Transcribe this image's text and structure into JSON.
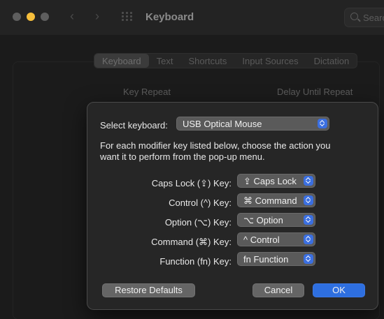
{
  "window": {
    "title": "Keyboard"
  },
  "search": {
    "placeholder": "Search"
  },
  "tabs": [
    "Keyboard",
    "Text",
    "Shortcuts",
    "Input Sources",
    "Dictation"
  ],
  "background": {
    "key_repeat_label": "Key Repeat",
    "delay_label": "Delay Until Repeat"
  },
  "sheet": {
    "select_keyboard_label": "Select keyboard:",
    "select_keyboard_value": "USB Optical Mouse",
    "description_line1": "For each modifier key listed below, choose the action you",
    "description_line2": "want it to perform from the pop-up menu.",
    "rows": [
      {
        "label": "Caps Lock (⇪) Key:",
        "value": "⇪ Caps Lock"
      },
      {
        "label": "Control (^) Key:",
        "value": "⌘ Command"
      },
      {
        "label": "Option (⌥) Key:",
        "value": "⌥ Option"
      },
      {
        "label": "Command (⌘) Key:",
        "value": "^ Control"
      },
      {
        "label": "Function (fn) Key:",
        "value": "fn Function"
      }
    ],
    "restore_label": "Restore Defaults",
    "cancel_label": "Cancel",
    "ok_label": "OK"
  },
  "colors": {
    "accent": "#2e6fe0",
    "minimize": "#f6be3b"
  }
}
